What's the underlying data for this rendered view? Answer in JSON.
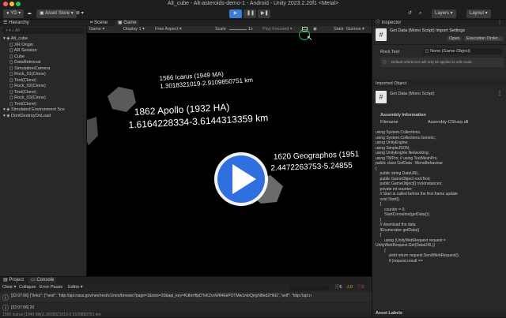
{
  "window": {
    "title": "Alt_cube - Alt-asteroids-demo-1 - Android - Unity 2023.2.20f1 <Metal>"
  },
  "toolbar": {
    "account": "YD",
    "asset_store": "Asset Store",
    "layers": "Layers",
    "layout": "Layout"
  },
  "hierarchy": {
    "tab": "Hierarchy",
    "search_placeholder": "All",
    "items": [
      {
        "label": "Alt_cube",
        "depth": 0
      },
      {
        "label": "XR Origin",
        "depth": 1
      },
      {
        "label": "AR Session",
        "depth": 1
      },
      {
        "label": "Cube",
        "depth": 1
      },
      {
        "label": "DataRetrieval",
        "depth": 1
      },
      {
        "label": "SimulationCamera",
        "depth": 1
      },
      {
        "label": "Rock_01(Clone)",
        "depth": 1
      },
      {
        "label": "Text(Clone)",
        "depth": 1
      },
      {
        "label": "Rock_02(Clone)",
        "depth": 1
      },
      {
        "label": "Text(Clone)",
        "depth": 1
      },
      {
        "label": "Rock_03(Clone)",
        "depth": 1
      },
      {
        "label": "Text(Clone)",
        "depth": 1
      },
      {
        "label": "Simulated Environment Sce",
        "depth": 0
      },
      {
        "label": "DontDestroyOnLoad",
        "depth": 0
      }
    ]
  },
  "scene": {
    "tab_scene": "Scene",
    "tab_game": "Game",
    "game_label": "Game",
    "display": "Display 1",
    "aspect": "Free Aspect",
    "scale_label": "Scale",
    "scale_value": "1x",
    "play_focused": "Play Focused",
    "stats": "Stats",
    "gizmos": "Gizmos",
    "labels": [
      {
        "line1": "1566 Icarus (1949 MA)",
        "line2": "1.3018321019-2.9109850751 km"
      },
      {
        "line1": "1862 Apollo (1932 HA)",
        "line2": "1.6164228334-3.6144313359 km"
      },
      {
        "line1": "1620 Geographos (1951",
        "line2": "2.4472263753-5.24855"
      }
    ]
  },
  "inspector": {
    "tab": "Inspector",
    "title": "Get Data (Mono Script) Import Settings",
    "open": "Open",
    "execution_order": "Execution Order...",
    "rock_text_label": "Rock Text",
    "rock_text_value": "None (Game Object)",
    "note": "Default references will only be applied in edit mode.",
    "imported_object": "Imported Object",
    "object_name": "Get Data (Mono Script)",
    "assembly_info": "Assembly Information",
    "filename_label": "Filename",
    "filename_value": "Assembly-CSharp.dll",
    "asset_labels": "Asset Labels",
    "code": [
      "using System.Collections;",
      "using System.Collections.Generic;",
      "using UnityEngine;",
      "using SimpleJSON;",
      "using UnityEngine.Networking;",
      "using TMPro; // using TextMeshPro",
      "",
      "public class GetData : MonoBehaviour",
      "{",
      "    public string DataURL;",
      "    public GameObject rockText;",
      "    public GameObject[] rockInstances;",
      "    private int counter;",
      "",
      "    // Start is called before the first frame update",
      "    void Start()",
      "    {",
      "        counter = 0;",
      "        StartCoroutine(getData());",
      "    }",
      "",
      "    // download the data",
      "    IEnumerator getData()",
      "    {",
      "        using (UnityWebRequest request =",
      "UnityWebRequest.Get(DataURL))",
      "        {",
      "            yield return request.SendWebRequest();",
      "",
      "            if (request.result =="
    ]
  },
  "console": {
    "tab_project": "Project",
    "tab_console": "Console",
    "clear": "Clear",
    "collapse": "Collapse",
    "error_pause": "Error Pause",
    "editor": "Editor",
    "count_info": "6",
    "count_warn": "0",
    "count_error": "0",
    "log1": "[22:07:06] {\"links\": {\"next\": \"http://api.nasa.gov/neo/rest/v1/neo/browse?page=1&size=20&api_key=KdbnHlpDTsKZvxW84EkPOTMw1mbQejyN8edZH6G\",\"self\": \"http://api.n",
    "log2": "[22:07:06] 20",
    "log3": "1566 Icarus (1949 MA)1.3018321019-2.9109850751 km"
  },
  "colors": {
    "accent_play": "#3a7bd5",
    "panel": "#282828"
  }
}
